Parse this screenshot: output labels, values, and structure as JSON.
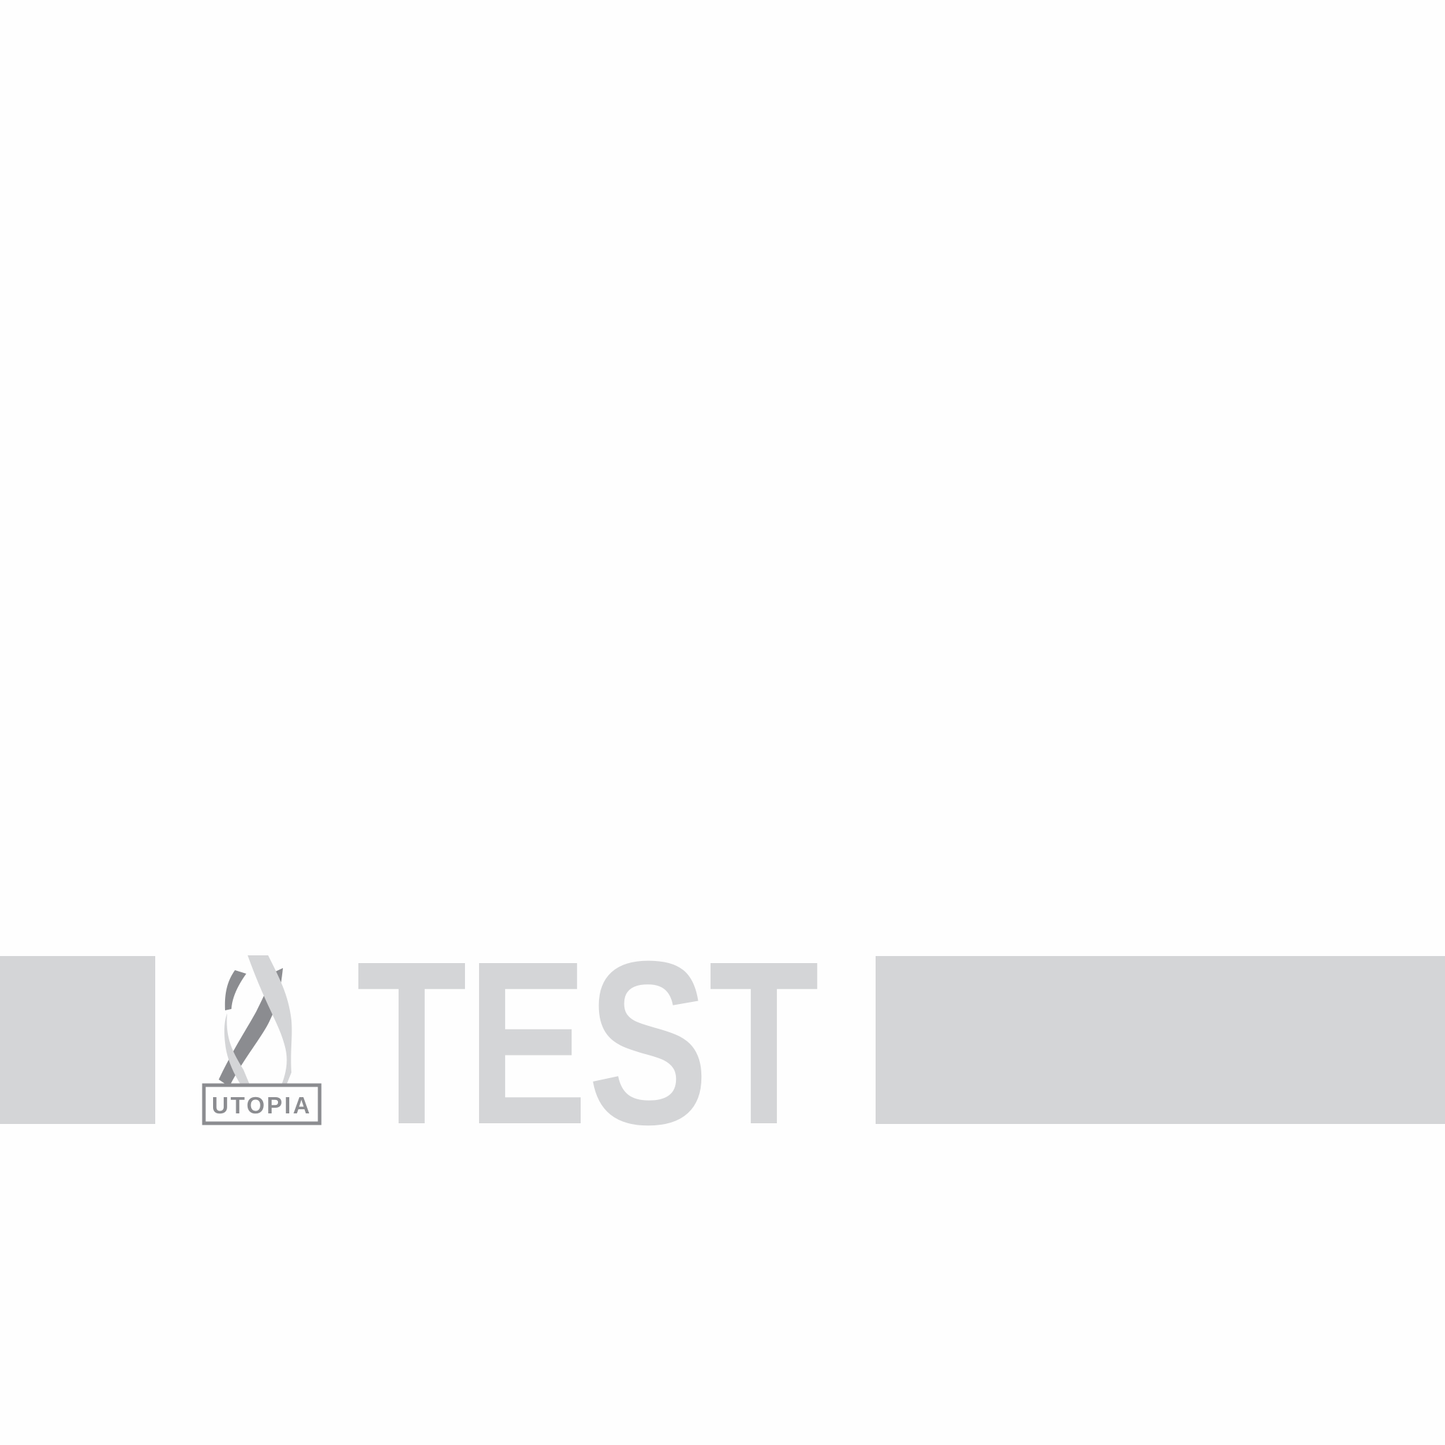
{
  "logo": {
    "wordmark": "UTOPIA",
    "icon": "ribbon-x-emblem"
  },
  "headline": {
    "text": "TEST"
  },
  "colors": {
    "background": "#fefefe",
    "band": "#d4d5d7",
    "logo_dark": "#8b8c90",
    "logo_light": "#d4d5d7",
    "text": "#d4d5d7"
  }
}
